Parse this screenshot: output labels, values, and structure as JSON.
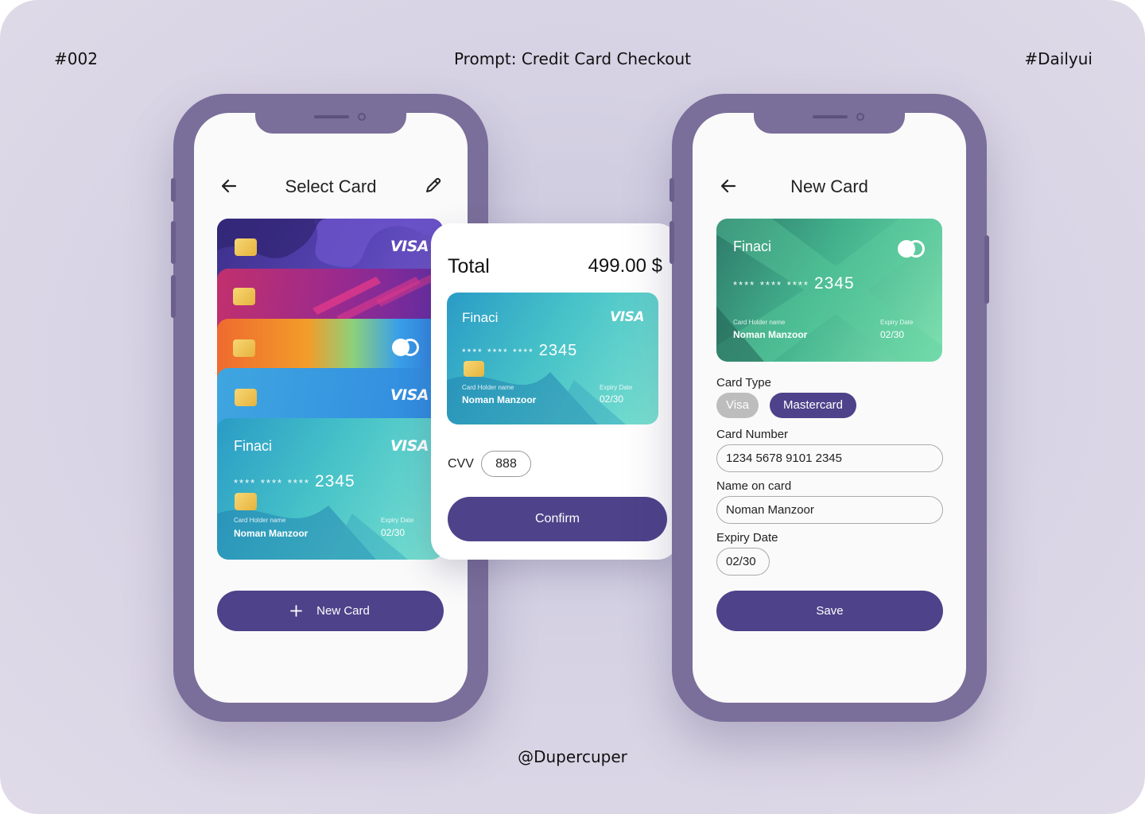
{
  "header": {
    "number": "#002",
    "prompt": "Prompt: Credit Card Checkout",
    "tag": "#Dailyui"
  },
  "footer": {
    "handle": "@Dupercuper"
  },
  "colors": {
    "primary": "#4e428a",
    "phone_frame": "#7a6e9a",
    "background": "#d9d4e6"
  },
  "select_screen": {
    "title": "Select Card",
    "back_icon": "arrow-left-icon",
    "edit_icon": "pencil-icon",
    "cards": [
      {
        "brand_mark": "VISA",
        "theme": "purple-waves"
      },
      {
        "brand_mark": "",
        "theme": "magenta-stripes"
      },
      {
        "brand_mark": "mastercard",
        "theme": "orange-green"
      },
      {
        "brand_mark": "VISA",
        "theme": "blue"
      }
    ],
    "front_card": {
      "brand": "Finaci",
      "network": "VISA",
      "masked": "**** **** ****",
      "last4": "2345",
      "holder_label": "Card Holder name",
      "holder": "Noman Manzoor",
      "expiry_label": "Expiry Date",
      "expiry": "02/30"
    },
    "new_card_button": {
      "icon": "plus-icon",
      "label": "New Card"
    }
  },
  "checkout": {
    "total_label": "Total",
    "total_value": "499.00 $",
    "card": {
      "brand": "Finaci",
      "network": "VISA",
      "masked": "**** **** ****",
      "last4": "2345",
      "holder_label": "Card Holder name",
      "holder": "Noman Manzoor",
      "expiry_label": "Expiry Date",
      "expiry": "02/30"
    },
    "cvv_label": "CVV",
    "cvv_value": "888",
    "confirm_label": "Confirm"
  },
  "new_screen": {
    "title": "New Card",
    "back_icon": "arrow-left-icon",
    "card": {
      "brand": "Finaci",
      "network": "mastercard",
      "masked": "**** **** ****",
      "last4": "2345",
      "holder_label": "Card Holder name",
      "holder": "Noman Manzoor",
      "expiry_label": "Expiry Date",
      "expiry": "02/30"
    },
    "card_type_label": "Card Type",
    "card_types": [
      "Visa",
      "Mastercard"
    ],
    "selected_type": "Mastercard",
    "card_number_label": "Card Number",
    "card_number_value": "1234 5678 9101 2345",
    "name_label": "Name on card",
    "name_value": "Noman Manzoor",
    "expiry_label": "Expiry Date",
    "expiry_value": "02/30",
    "save_label": "Save"
  }
}
